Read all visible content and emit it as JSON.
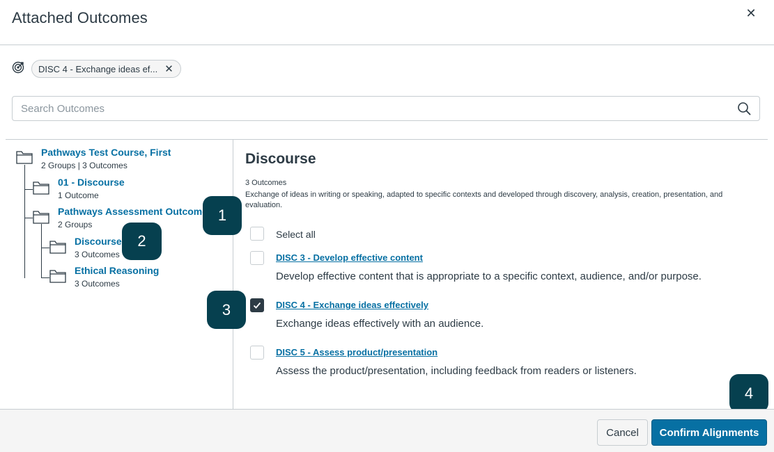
{
  "dialog": {
    "title": "Attached Outcomes",
    "close_label": "✕"
  },
  "selected_pill": {
    "label": "DISC 4 - Exchange ideas ef...",
    "remove_label": "✕",
    "icon": "target-icon"
  },
  "search": {
    "placeholder": "Search Outcomes",
    "value": ""
  },
  "tree": {
    "root": {
      "title": "Pathways Test Course, First",
      "sub": "2 Groups | 3 Outcomes"
    },
    "children": [
      {
        "title": "01 - Discourse",
        "sub": "1 Outcome"
      },
      {
        "title": "Pathways Assessment Outcomes",
        "sub": "2 Groups"
      }
    ],
    "grandchildren": [
      {
        "title": "Discourse",
        "sub": "3 Outcomes"
      },
      {
        "title": "Ethical Reasoning",
        "sub": "3 Outcomes"
      }
    ]
  },
  "group": {
    "title": "Discourse",
    "count": "3 Outcomes",
    "description": "Exchange of ideas in writing or speaking, adapted to specific contexts and developed through discovery, analysis, creation, presentation, and evaluation.",
    "select_all_label": "Select all"
  },
  "outcomes": [
    {
      "title": "DISC 3 - Develop effective content",
      "description": "Develop effective content that is appropriate to a specific context, audience, and/or purpose.",
      "checked": false
    },
    {
      "title": "DISC 4 - Exchange ideas effectively",
      "description": "Exchange ideas effectively with an audience.",
      "checked": true
    },
    {
      "title": "DISC 5 - Assess product/presentation",
      "description": "Assess the product/presentation, including feedback from readers or listeners.",
      "checked": false
    }
  ],
  "badges": [
    "1",
    "2",
    "3",
    "4"
  ],
  "footer": {
    "cancel_label": "Cancel",
    "confirm_label": "Confirm Alignments"
  },
  "colors": {
    "link": "#0770a3",
    "text": "#2d3b45",
    "badge": "#06404f",
    "primary_button": "#0770a3"
  }
}
